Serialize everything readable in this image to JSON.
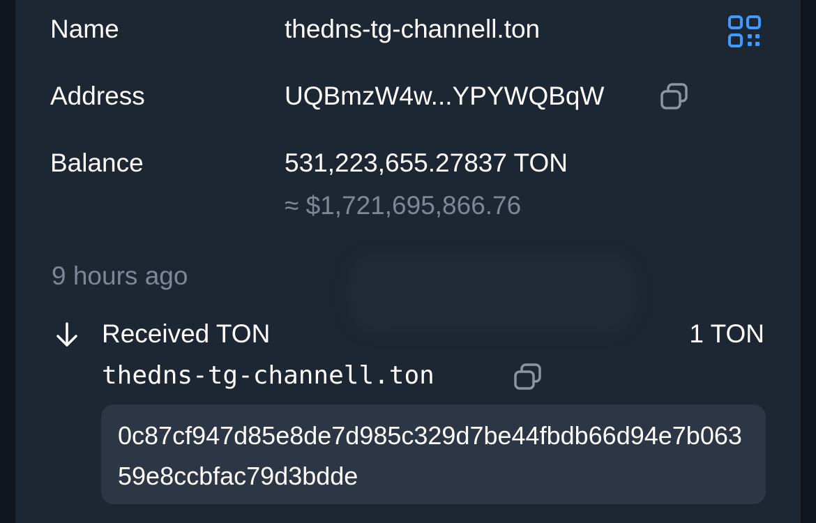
{
  "wallet": {
    "name_label": "Name",
    "name_value": "thedns-tg-channell.ton",
    "address_label": "Address",
    "address_value": "UQBmzW4w...YPYWQBqW",
    "balance_label": "Balance",
    "balance_value": "531,223,655.27837 TON",
    "balance_fiat": "≈ $1,721,695,866.76"
  },
  "transaction": {
    "time": "9 hours ago",
    "title": "Received TON",
    "amount": "1 TON",
    "address": "thedns-tg-channell.ton",
    "hash": "0c87cf947d85e8de7d985c329d7be44fbdb66d94e7b06359e8ccbfac79d3bdde"
  },
  "icons": {
    "qr": "qr-code-icon",
    "copy": "copy-icon",
    "arrow": "arrow-down-icon"
  },
  "colors": {
    "accent": "#3e9bff",
    "card": "#1d2633",
    "hash_bg": "#2c3645",
    "muted_text": "#7c8797"
  }
}
